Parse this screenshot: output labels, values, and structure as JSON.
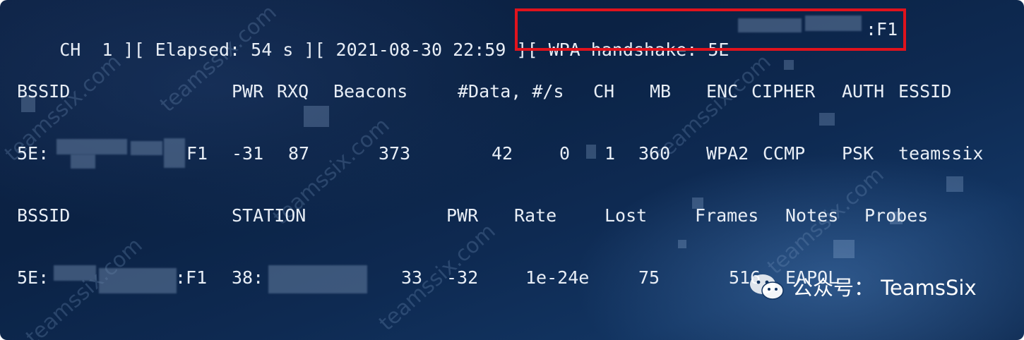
{
  "status_line": {
    "ch": "CH  1 ][ Elapsed: 54 s ][ 2021-08-30 22:59 ][ WPA handshake: 5E",
    "handshake_suffix": ":F1"
  },
  "ap_table": {
    "headers": [
      "BSSID",
      "PWR",
      "RXQ",
      "Beacons",
      "#Data, #/s",
      "CH",
      "MB",
      "ENC",
      "CIPHER",
      "AUTH",
      "ESSID"
    ],
    "row": {
      "bssid_prefix": "5E:",
      "bssid_suffix": "F1",
      "pwr": "-31",
      "rxq": "87",
      "beacons": "373",
      "data": "42",
      "per_s": "0",
      "ch": "1",
      "mb": "360",
      "enc": "WPA2",
      "cipher": "CCMP",
      "auth": "PSK",
      "essid": "teamssix"
    }
  },
  "station_table": {
    "headers": [
      "BSSID",
      "STATION",
      "PWR",
      "Rate",
      "Lost",
      "Frames",
      "Notes",
      "Probes"
    ],
    "row": {
      "bssid_prefix": "5E:",
      "bssid_suffix": ":F1",
      "station_prefix": "38:",
      "pwr": "33",
      "rate": "-32",
      "lost": "1e-24e",
      "frames": "75",
      "notes": "516",
      "probes": "EAPOL"
    }
  },
  "watermark": {
    "account": "公众号： TeamsSix",
    "repeat_text": "teamssix.com"
  },
  "colors": {
    "highlight": "#e0131d",
    "text": "#e8eef6",
    "background": "#0e2346"
  }
}
